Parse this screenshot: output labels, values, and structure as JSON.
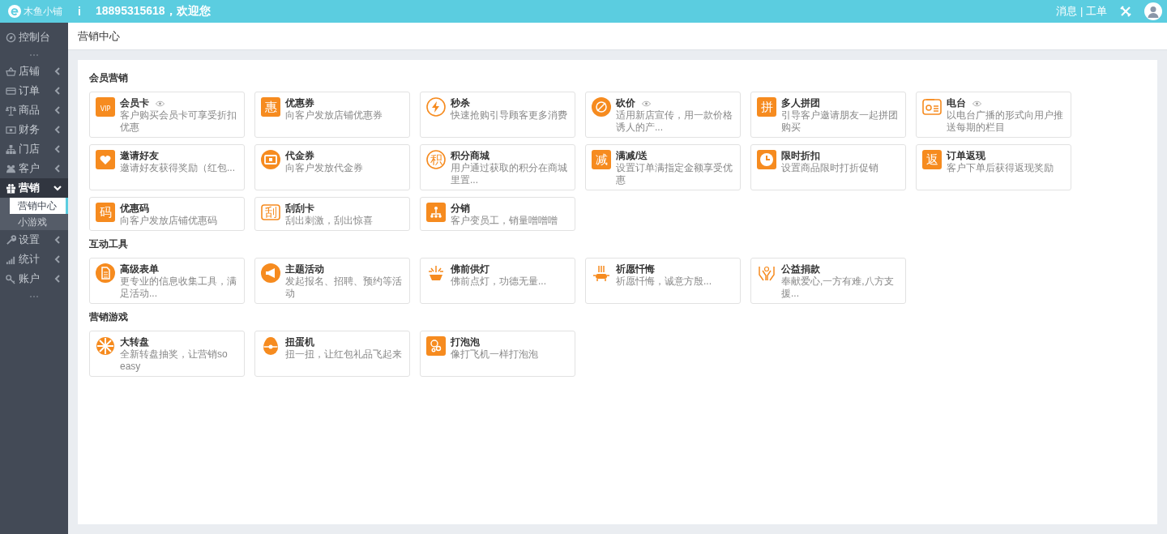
{
  "topbar": {
    "logo": "木鱼小铺",
    "info": "i",
    "greeting": "18895315618，欢迎您",
    "links": [
      "消息 | 工单"
    ]
  },
  "sidebar": {
    "items": [
      {
        "label": "控制台",
        "expanded": false
      },
      {
        "label": "店铺",
        "expanded": false
      },
      {
        "label": "订单",
        "expanded": false
      },
      {
        "label": "商品",
        "expanded": false
      },
      {
        "label": "财务",
        "expanded": false
      },
      {
        "label": "门店",
        "expanded": false
      },
      {
        "label": "客户",
        "expanded": false
      },
      {
        "label": "营销",
        "expanded": true,
        "children": [
          {
            "label": "营销中心",
            "selected": true
          },
          {
            "label": "小游戏",
            "selected": false
          }
        ]
      },
      {
        "label": "设置",
        "expanded": false
      },
      {
        "label": "统计",
        "expanded": false
      },
      {
        "label": "账户",
        "expanded": false
      }
    ]
  },
  "page_title": "营销中心",
  "sections": [
    {
      "title": "会员营销",
      "cards": [
        {
          "title": "会员卡",
          "desc": "客户购买会员卡可享受折扣优惠",
          "preview": true,
          "glyph": "VIP"
        },
        {
          "title": "优惠券",
          "desc": "向客户发放店铺优惠券",
          "preview": false,
          "glyph": "惠"
        },
        {
          "title": "秒杀",
          "desc": "快速抢购引导顾客更多消费",
          "preview": false
        },
        {
          "title": "砍价",
          "desc": "适用新店宣传，用一款价格诱人的产...",
          "preview": true
        },
        {
          "title": "多人拼团",
          "desc": "引导客户邀请朋友一起拼团购买",
          "preview": false,
          "glyph": "拼"
        },
        {
          "title": "电台",
          "desc": "以电台广播的形式向用户推送每期的栏目",
          "preview": true
        },
        {
          "title": "邀请好友",
          "desc": "邀请好友获得奖励（红包...",
          "preview": false
        },
        {
          "title": "代金券",
          "desc": "向客户发放代金券",
          "preview": false
        },
        {
          "title": "积分商城",
          "desc": "用户通过获取的积分在商城里置...",
          "preview": false,
          "glyph": "积"
        },
        {
          "title": "满减/送",
          "desc": "设置订单满指定金额享受优惠",
          "preview": false,
          "glyph": "减"
        },
        {
          "title": "限时折扣",
          "desc": "设置商品限时打折促销",
          "preview": false
        },
        {
          "title": "订单返现",
          "desc": "客户下单后获得返现奖励",
          "preview": false,
          "glyph": "返"
        },
        {
          "title": "优惠码",
          "desc": "向客户发放店铺优惠码",
          "preview": false,
          "glyph": "码"
        },
        {
          "title": "刮刮卡",
          "desc": "刮出刺激，刮出惊喜",
          "preview": false,
          "glyph": "刮"
        },
        {
          "title": "分销",
          "desc": "客户变员工，销量噌噌噌",
          "preview": false
        }
      ]
    },
    {
      "title": "互动工具",
      "cards": [
        {
          "title": "高级表单",
          "desc": "更专业的信息收集工具，满足活动...",
          "preview": false
        },
        {
          "title": "主题活动",
          "desc": "发起报名、招聘、预约等活动",
          "preview": false
        },
        {
          "title": "佛前供灯",
          "desc": "佛前点灯，功德无量...",
          "preview": false
        },
        {
          "title": "祈愿忏悔",
          "desc": "祈愿忏悔，诚意方殷...",
          "preview": false
        },
        {
          "title": "公益捐款",
          "desc": "奉献爱心,一方有难,八方支援...",
          "preview": false
        }
      ]
    },
    {
      "title": "营销游戏",
      "cards": [
        {
          "title": "大转盘",
          "desc": "全新转盘抽奖，让营销so easy",
          "preview": false
        },
        {
          "title": "扭蛋机",
          "desc": "扭一扭，让红包礼品飞起来",
          "preview": false
        },
        {
          "title": "打泡泡",
          "desc": "像打飞机一样打泡泡",
          "preview": false
        }
      ]
    }
  ]
}
